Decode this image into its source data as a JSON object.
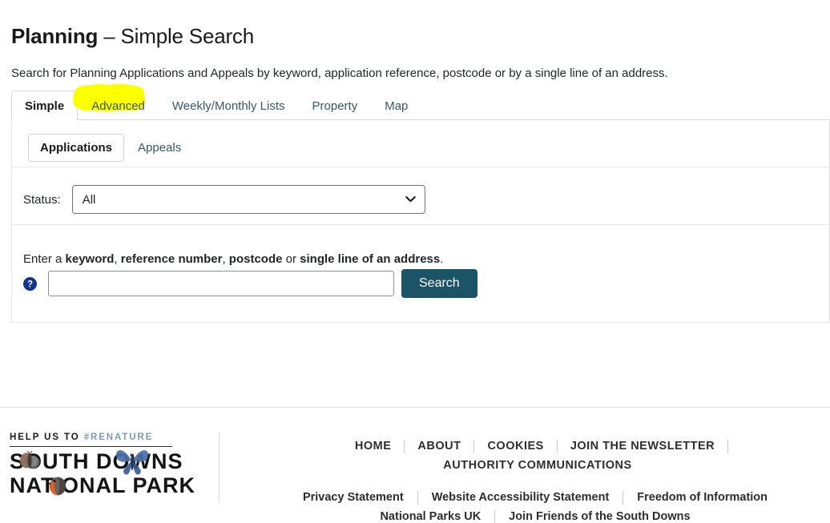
{
  "header": {
    "title_strong": "Planning",
    "title_dash": "–",
    "title_light": "Simple Search",
    "intro": "Search for Planning Applications and Appeals by keyword, application reference, postcode or by a single line of an address."
  },
  "tabs": [
    {
      "label": "Simple",
      "active": true,
      "highlighted": false
    },
    {
      "label": "Advanced",
      "active": false,
      "highlighted": true
    },
    {
      "label": "Weekly/Monthly Lists",
      "active": false,
      "highlighted": false
    },
    {
      "label": "Property",
      "active": false,
      "highlighted": false
    },
    {
      "label": "Map",
      "active": false,
      "highlighted": false
    }
  ],
  "subtabs": [
    {
      "label": "Applications",
      "active": true
    },
    {
      "label": "Appeals",
      "active": false
    }
  ],
  "form": {
    "status_label": "Status:",
    "status_value": "All",
    "status_options": [
      "All"
    ],
    "hint_prefix": "Enter a ",
    "hint_kw": "keyword",
    "hint_sep1": ", ",
    "hint_ref": "reference number",
    "hint_sep2": ", ",
    "hint_pc": "postcode",
    "hint_or": " or ",
    "hint_addr": "single line of an address",
    "hint_end": ".",
    "search_value": "",
    "search_placeholder": "",
    "search_button": "Search",
    "help_icon": "help-circle-icon",
    "chevron_icon": "chevron-down-icon"
  },
  "footer": {
    "logo": {
      "tagline_lead": "HELP US TO ",
      "tagline_accent": "#RENATURE",
      "wordmark_line1": "SOUTH DOWNS",
      "wordmark_line2": "NATIONAL PARK",
      "art": [
        "moth-icon",
        "butterfly-icon",
        "robin-icon"
      ]
    },
    "primary_links": [
      "HOME",
      "ABOUT",
      "COOKIES",
      "JOIN THE NEWSLETTER",
      "AUTHORITY"
    ],
    "primary_overflow": "COMMUNICATIONS",
    "secondary_links_row1": [
      "Privacy Statement",
      "Website Accessibility Statement",
      "Freedom of Information"
    ],
    "secondary_links_row2": [
      "National Parks UK",
      "Join Friends of the South Downs"
    ]
  },
  "colors": {
    "accent_button": "#1c5366",
    "link": "#3a566b",
    "highlight": "#fbff00",
    "help_icon": "#12348f",
    "renature": "#7c9ab8"
  }
}
